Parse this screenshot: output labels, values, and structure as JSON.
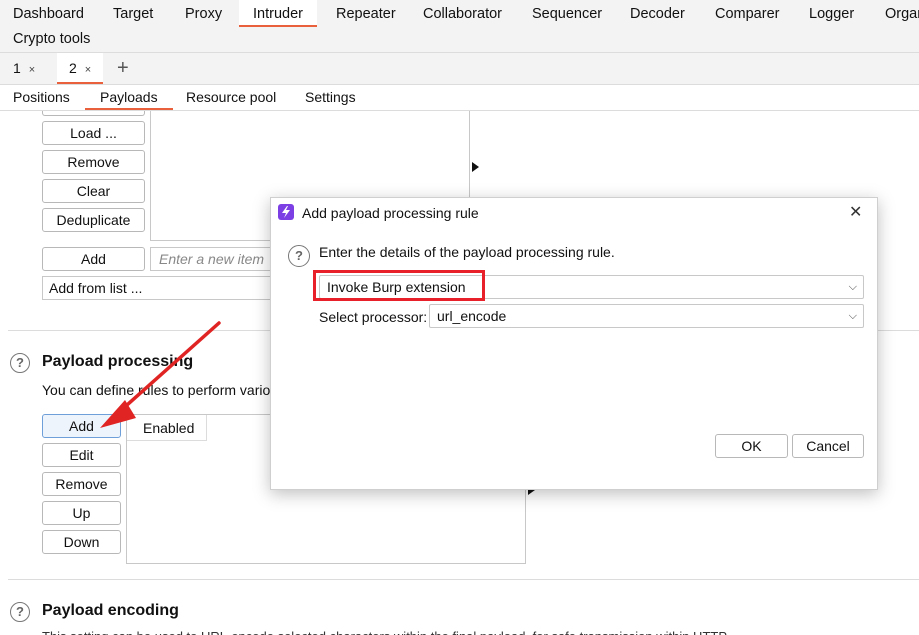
{
  "menu": {
    "items": [
      "Dashboard",
      "Target",
      "Proxy",
      "Intruder",
      "Repeater",
      "Collaborator",
      "Sequencer",
      "Decoder",
      "Comparer",
      "Logger",
      "Organ"
    ],
    "second_row": "Crypto tools"
  },
  "instance_tabs": {
    "tabs": [
      "1",
      "2"
    ],
    "close": "×",
    "add": "+"
  },
  "sub_tabs": [
    "Positions",
    "Payloads",
    "Resource pool",
    "Settings"
  ],
  "payload_list": {
    "buttons": {
      "load": "Load ...",
      "remove": "Remove",
      "clear": "Clear",
      "deduplicate": "Deduplicate",
      "add": "Add",
      "add_from_list": "Add from list ..."
    },
    "new_item_placeholder": "Enter a new item"
  },
  "processing": {
    "title": "Payload processing",
    "description": "You can define rules to perform vario",
    "buttons": {
      "add": "Add",
      "edit": "Edit",
      "remove": "Remove",
      "up": "Up",
      "down": "Down"
    },
    "table_header": "Enabled"
  },
  "encoding": {
    "title": "Payload encoding",
    "description": "This setting can be used to URL-encode selected characters within the final payload, for safe transmission within HTTP"
  },
  "dialog": {
    "title": "Add payload processing rule",
    "message": "Enter the details of the payload processing rule.",
    "rule_type": "Invoke Burp extension",
    "processor_label": "Select processor:",
    "processor_value": "url_encode",
    "ok": "OK",
    "cancel": "Cancel",
    "close": "✕"
  },
  "colors": {
    "accent": "#e8603c",
    "highlight": "#e8202a",
    "arrow": "#e02424",
    "logo": "#7b3fe4"
  }
}
